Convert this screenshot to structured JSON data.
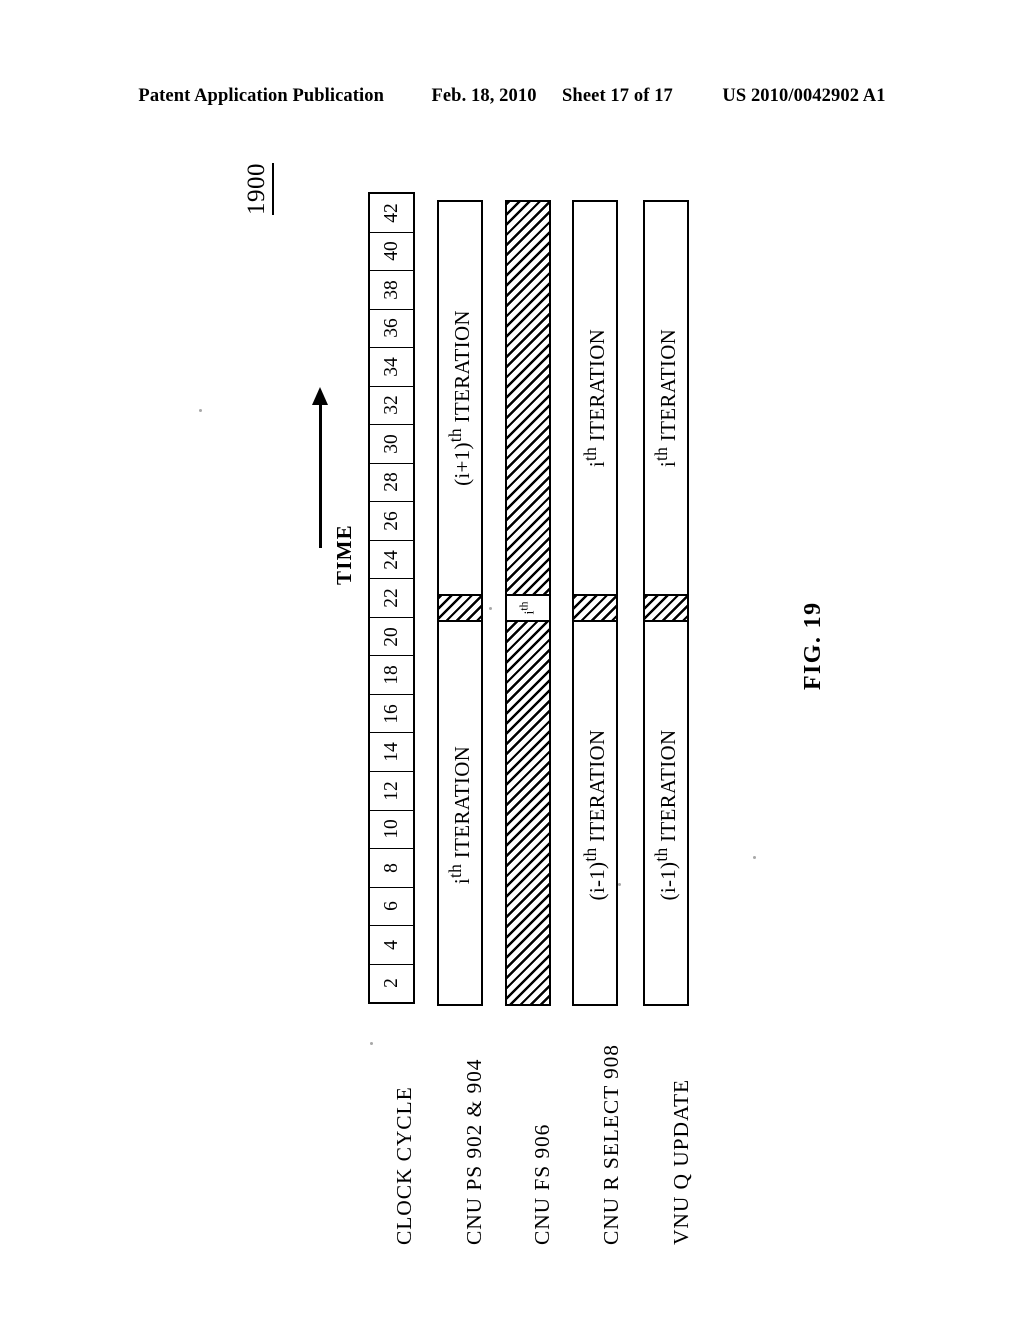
{
  "header": {
    "publication": "Patent Application Publication",
    "date": "Feb. 18, 2010",
    "sheet": "Sheet 17 of 17",
    "patent_number": "US 2010/0042902 A1"
  },
  "figure": {
    "number_label": "1900",
    "caption": "FIG. 19",
    "axis_label": "TIME",
    "axis_arrow_direction": "right"
  },
  "chart_data": {
    "type": "timing-diagram",
    "title": "FIG. 19",
    "xlabel": "TIME",
    "orientation": "rotated-90-ccw",
    "clock_cycle_label": "CLOCK CYCLE",
    "clock_cycles": [
      2,
      4,
      6,
      8,
      10,
      12,
      14,
      16,
      18,
      20,
      22,
      24,
      26,
      28,
      30,
      32,
      34,
      36,
      38,
      40,
      42
    ],
    "rows": [
      {
        "name": "CNU PS 902 & 904",
        "fill": "open",
        "segments": [
          {
            "label_html": "i<sup>th</sup> ITERATION",
            "label_text": "ith ITERATION",
            "style": "open"
          },
          {
            "label_html": "",
            "label_text": "",
            "style": "hatched"
          },
          {
            "label_html": "(i+1)<sup>th</sup> ITERATION",
            "label_text": "(i+1)th ITERATION",
            "style": "open"
          }
        ]
      },
      {
        "name": "CNU FS 906",
        "fill": "hatched",
        "segments": [
          {
            "label_html": "",
            "label_text": "",
            "style": "hatched"
          },
          {
            "label_html": "i<sup>th</sup>",
            "label_text": "ith",
            "style": "open"
          },
          {
            "label_html": "",
            "label_text": "",
            "style": "hatched"
          }
        ]
      },
      {
        "name": "CNU R SELECT 908",
        "fill": "open",
        "segments": [
          {
            "label_html": "(i-1)<sup>th</sup> ITERATION",
            "label_text": "(i-1)th ITERATION",
            "style": "open"
          },
          {
            "label_html": "",
            "label_text": "",
            "style": "hatched"
          },
          {
            "label_html": "i<sup>th</sup> ITERATION",
            "label_text": "ith ITERATION",
            "style": "open"
          }
        ]
      },
      {
        "name": "VNU Q UPDATE",
        "fill": "open",
        "segments": [
          {
            "label_html": "(i-1)<sup>th</sup> ITERATION",
            "label_text": "(i-1)th ITERATION",
            "style": "open"
          },
          {
            "label_html": "",
            "label_text": "",
            "style": "hatched"
          },
          {
            "label_html": "i<sup>th</sup> ITERATION",
            "label_text": "ith ITERATION",
            "style": "open"
          }
        ]
      }
    ]
  }
}
